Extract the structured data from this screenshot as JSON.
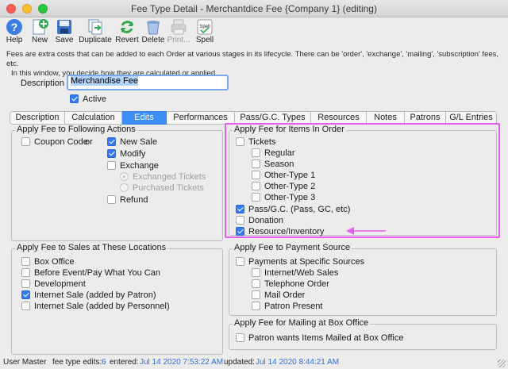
{
  "window": {
    "title": "Fee Type Detail - Merchantdice Fee {Company 1} (editing)"
  },
  "toolbar": [
    {
      "label": "Help",
      "icon": "help-icon",
      "enabled": true
    },
    {
      "label": "New",
      "icon": "new-icon",
      "enabled": true
    },
    {
      "label": "Save",
      "icon": "save-icon",
      "enabled": true
    },
    {
      "label": "Duplicate",
      "icon": "duplicate-icon",
      "enabled": true
    },
    {
      "label": "Revert",
      "icon": "revert-icon",
      "enabled": true
    },
    {
      "label": "Delete",
      "icon": "trash-icon",
      "enabled": true
    },
    {
      "label": "Print...",
      "icon": "print-icon",
      "enabled": false
    },
    {
      "label": "Spell",
      "icon": "spell-icon",
      "enabled": true
    }
  ],
  "info": {
    "line1": "Fees are extra costs that can be added to each Order at various stages in its lifecycle.  There can be 'order', 'exchange', 'mailing', 'subscription' fees, etc.",
    "line2": "In this window, you decide how they are calculated or applied."
  },
  "form": {
    "description_label": "Description",
    "description_value": "Merchandise Fee",
    "active_label": "Active",
    "active_checked": true
  },
  "tabs": [
    {
      "label": "Description",
      "selected": false
    },
    {
      "label": "Calculation",
      "selected": false
    },
    {
      "label": "Edits",
      "selected": true
    },
    {
      "label": "Performances",
      "selected": false
    },
    {
      "label": "Pass/G.C. Types",
      "selected": false
    },
    {
      "label": "Resources",
      "selected": false
    },
    {
      "label": "Notes",
      "selected": false
    },
    {
      "label": "Patrons",
      "selected": false
    },
    {
      "label": "G/L Entries",
      "selected": false
    }
  ],
  "actions": {
    "title": "Apply Fee to Following Actions",
    "coupon_code": {
      "label": "Coupon Code",
      "checked": false
    },
    "or_text": "or",
    "new_sale": {
      "label": "New Sale",
      "checked": true
    },
    "modify": {
      "label": "Modify",
      "checked": true
    },
    "exchange": {
      "label": "Exchange",
      "checked": false
    },
    "exchanged_tickets": {
      "label": "Exchanged Tickets",
      "selected": true
    },
    "purchased_tickets": {
      "label": "Purchased Tickets",
      "selected": false
    },
    "refund": {
      "label": "Refund",
      "checked": false
    }
  },
  "items": {
    "title": "Apply Fee for Items In Order",
    "tickets": {
      "label": "Tickets",
      "checked": false
    },
    "regular": {
      "label": "Regular",
      "checked": false
    },
    "season": {
      "label": "Season",
      "checked": false
    },
    "other1": {
      "label": "Other-Type 1",
      "checked": false
    },
    "other2": {
      "label": "Other-Type 2",
      "checked": false
    },
    "other3": {
      "label": "Other-Type 3",
      "checked": false
    },
    "pass": {
      "label": "Pass/G.C. (Pass, GC, etc)",
      "checked": true
    },
    "donation": {
      "label": "Donation",
      "checked": false
    },
    "resource": {
      "label": "Resource/Inventory",
      "checked": true
    }
  },
  "locations": {
    "title": "Apply Fee to Sales at These Locations",
    "box_office": {
      "label": "Box Office",
      "checked": false
    },
    "before_event": {
      "label": "Before Event/Pay What You Can",
      "checked": false
    },
    "development": {
      "label": "Development",
      "checked": false
    },
    "internet_patron": {
      "label": "Internet Sale (added by Patron)",
      "checked": true
    },
    "internet_personnel": {
      "label": "Internet Sale (added by Personnel)",
      "checked": false
    }
  },
  "payment": {
    "title": "Apply Fee to Payment Source",
    "specific": {
      "label": "Payments at Specific Sources",
      "checked": false
    },
    "internet_web": {
      "label": "Internet/Web Sales",
      "checked": false
    },
    "telephone": {
      "label": "Telephone Order",
      "checked": false
    },
    "mail": {
      "label": "Mail Order",
      "checked": false
    },
    "patron_present": {
      "label": "Patron Present",
      "checked": false
    }
  },
  "mailing": {
    "title": "Apply Fee for Mailing at Box Office",
    "patron_mailed": {
      "label": "Patron wants Items Mailed at Box Office",
      "checked": false
    }
  },
  "status": {
    "user": "User Master",
    "edits_label": "fee type edits:",
    "edits_value": "6",
    "entered_label": "entered:",
    "entered_value": "Jul 14 2020 7:53:22 AM",
    "updated_label": "updated:",
    "updated_value": "Jul 14 2020 8:44:21 AM"
  },
  "colors": {
    "accent": "#3d8ef7",
    "highlight": "#e45ef0"
  }
}
